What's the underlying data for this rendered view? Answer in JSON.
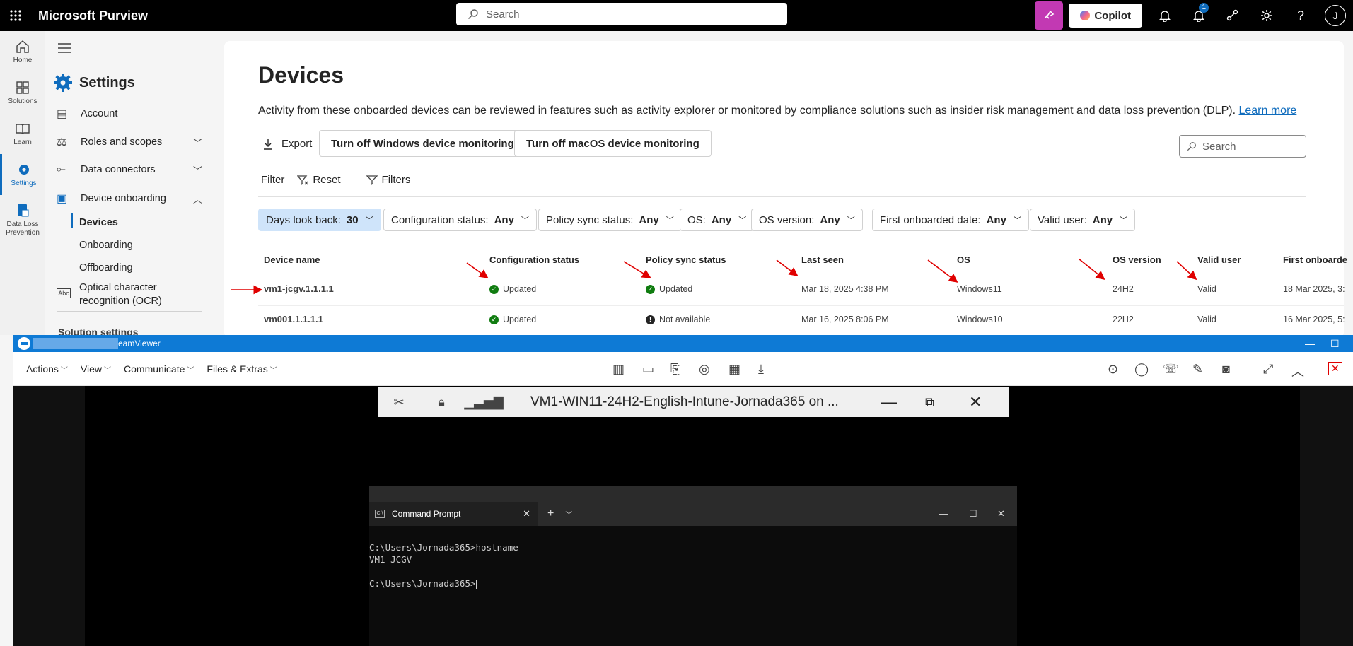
{
  "topbar": {
    "brand": "Microsoft Purview",
    "search_placeholder": "Search",
    "copilot_label": "Copilot",
    "notification_count": "1",
    "avatar_initial": "J"
  },
  "rail": [
    {
      "label": "Home",
      "icon": "home-icon"
    },
    {
      "label": "Solutions",
      "icon": "solutions-icon"
    },
    {
      "label": "Learn",
      "icon": "learn-icon"
    },
    {
      "label": "Settings",
      "icon": "gear-icon"
    },
    {
      "label": "Data Loss Prevention",
      "icon": "dlp-icon"
    }
  ],
  "sidenav": {
    "title": "Settings",
    "items": [
      {
        "label": "Account"
      },
      {
        "label": "Roles and scopes"
      },
      {
        "label": "Data connectors"
      },
      {
        "label": "Device onboarding"
      }
    ],
    "subitems": [
      "Devices",
      "Onboarding",
      "Offboarding"
    ],
    "ocr_line1": "Optical character",
    "ocr_line2": "recognition (OCR)",
    "section": "Solution settings"
  },
  "page": {
    "title": "Devices",
    "description": "Activity from these onboarded devices can be reviewed in features such as activity explorer or monitored by compliance solutions such as insider risk management and data loss prevention (DLP).",
    "learn_more": "Learn more",
    "export_label": "Export",
    "btn_windows": "Turn off Windows device monitoring",
    "btn_macos": "Turn off macOS device monitoring",
    "search_placeholder": "Search",
    "filter_label": "Filter",
    "reset_label": "Reset",
    "filters_label": "Filters"
  },
  "chips": [
    {
      "label": "Days look back:",
      "value": "30"
    },
    {
      "label": "Configuration status:",
      "value": "Any"
    },
    {
      "label": "Policy sync status:",
      "value": "Any"
    },
    {
      "label": "OS:",
      "value": "Any"
    },
    {
      "label": "OS version:",
      "value": "Any"
    },
    {
      "label": "First onboarded date:",
      "value": "Any"
    },
    {
      "label": "Valid user:",
      "value": "Any"
    }
  ],
  "table": {
    "columns": [
      "Device name",
      "Configuration status",
      "Policy sync status",
      "Last seen",
      "OS",
      "OS version",
      "Valid user",
      "First onboarde"
    ],
    "rows": [
      {
        "device": "vm1-jcgv.1.1.1.1",
        "config": "Updated",
        "policy": "Updated",
        "last_seen": "Mar 18, 2025 4:38 PM",
        "os": "Windows11",
        "os_version": "24H2",
        "valid": "Valid",
        "first": "18 Mar 2025, 3:"
      },
      {
        "device": "vm001.1.1.1.1",
        "config": "Updated",
        "policy": "Not available",
        "last_seen": "Mar 16, 2025 8:06 PM",
        "os": "Windows10",
        "os_version": "22H2",
        "valid": "Valid",
        "first": "16 Mar 2025, 5:"
      }
    ]
  },
  "teamviewer": {
    "title": "eamViewer",
    "menu": [
      "Actions",
      "View",
      "Communicate",
      "Files & Extras"
    ]
  },
  "remote_bar": {
    "title": "VM1-WIN11-24H2-English-Intune-Jornada365 on ..."
  },
  "cmd": {
    "tab_title": "Command Prompt",
    "line1": "C:\\Users\\Jornada365>hostname",
    "line2": "VM1-JCGV",
    "line3": "C:\\Users\\Jornada365>"
  },
  "colors": {
    "accent": "#0f6cbd",
    "teamviewer": "#0e7ad5",
    "annotation": "#e00000"
  }
}
